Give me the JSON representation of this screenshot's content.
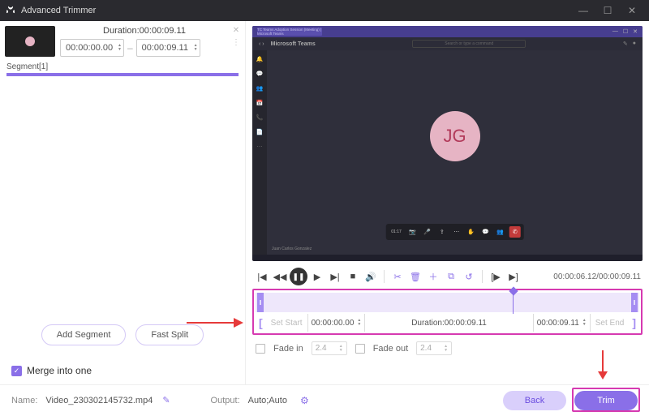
{
  "window": {
    "title": "Advanced Trimmer"
  },
  "segment": {
    "duration_label": "Duration:00:00:09.11",
    "start": "00:00:00.00",
    "end": "00:00:09.11",
    "caption": "Segment[1]"
  },
  "left_actions": {
    "add_segment": "Add Segment",
    "fast_split": "Fast Split",
    "merge_label": "Merge into one"
  },
  "preview": {
    "app_name": "Microsoft Teams",
    "tab_title": "TC Teams Adoption Session (Meeting) | Microsoft Teams",
    "search_placeholder": "Search or type a command",
    "avatar_initials": "JG",
    "participant_name": "Juan Carlos Gonzalez",
    "call_timer": "01:17"
  },
  "playback": {
    "current": "00:00:06.12",
    "total": "00:00:09.11",
    "timecode": "00:00:06.12/00:00:09.11"
  },
  "trim": {
    "set_start": "Set Start",
    "set_end": "Set End",
    "start": "00:00:00.00",
    "end": "00:00:09.11",
    "duration_label": "Duration:00:00:09.11"
  },
  "fade": {
    "in_label": "Fade in",
    "in_val": "2.4",
    "out_label": "Fade out",
    "out_val": "2.4"
  },
  "footer": {
    "name_label": "Name:",
    "name_value": "Video_230302145732.mp4",
    "output_label": "Output:",
    "output_value": "Auto;Auto",
    "back": "Back",
    "trim": "Trim"
  }
}
